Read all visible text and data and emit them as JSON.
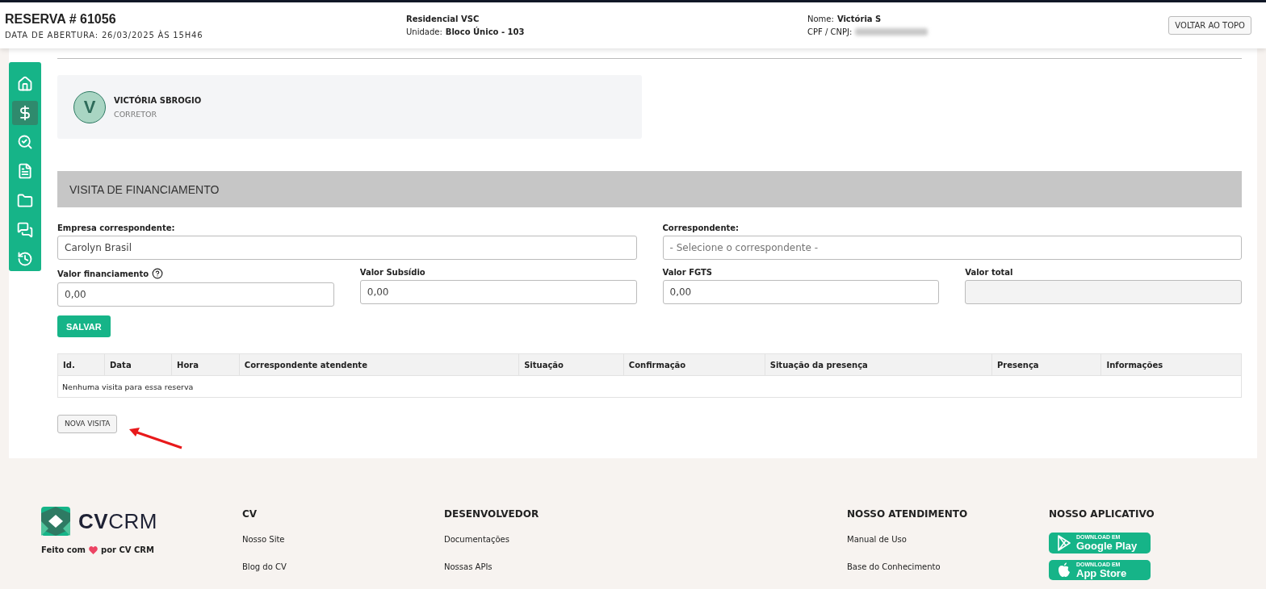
{
  "header": {
    "title": "RESERVA # 61056",
    "opening": "DATA DE ABERTURA: 26/03/2025 ÀS 15H46",
    "project": "Residencial VSC",
    "unit_label": "Unidade:",
    "unit_value": "Bloco Único - 103",
    "name_label": "Nome:",
    "name_value": "Victória S",
    "cpf_label": "CPF / CNPJ:",
    "cpf_redacted": true,
    "back_button": "VOLTAR AO TOPO"
  },
  "sidebar": {
    "items": [
      {
        "kind": "home",
        "selected": false
      },
      {
        "kind": "dollar",
        "selected": true
      },
      {
        "kind": "search",
        "selected": false
      },
      {
        "kind": "document",
        "selected": false
      },
      {
        "kind": "folder",
        "selected": false
      },
      {
        "kind": "chat",
        "selected": false
      },
      {
        "kind": "history",
        "selected": false
      }
    ]
  },
  "agent": {
    "initial": "V",
    "name": "VICTÓRIA SBROGIO",
    "role": "CORRETOR"
  },
  "section": {
    "title": "VISITA DE FINANCIAMENTO"
  },
  "fields": [
    {
      "kind": "text",
      "label": "Empresa correspondente:",
      "value": "Carolyn Brasil",
      "wide": true
    },
    {
      "kind": "select",
      "label": "Correspondente:",
      "placeholder": "- Selecione o correspondente -",
      "wide": true
    },
    {
      "kind": "text",
      "label": "Valor financiamento",
      "value": "0,00",
      "wide": false,
      "help": true
    },
    {
      "kind": "text",
      "label": "Valor Subsídio",
      "value": "0,00",
      "wide": false
    },
    {
      "kind": "text",
      "label": "Valor FGTS",
      "value": "0,00",
      "wide": false
    },
    {
      "kind": "readonly",
      "label": "Valor total",
      "wide": false
    }
  ],
  "save_button": "SALVAR",
  "table": {
    "columns": [
      "Id.",
      "Data",
      "Hora",
      "Correspondente atendente",
      "Situação",
      "Confirmação",
      "Situação da presença",
      "Presença",
      "Informações"
    ],
    "empty": "Nenhuma visita para essa reserva"
  },
  "new_visit_button": "NOVA VISITA",
  "footer": {
    "logo": "**CV**CRM",
    "made_with": [
      "Feito com",
      "por CV CRM"
    ],
    "columns": [
      {
        "title": "CV",
        "links": [
          "Nosso Site",
          "Blog do CV"
        ]
      },
      {
        "title": "DESENVOLVEDOR",
        "links": [
          "Documentações",
          "Nossas APIs"
        ]
      },
      {
        "title": "NOSSO ATENDIMENTO",
        "links": [
          "Manual de Uso",
          "Base do Conhecimento"
        ]
      }
    ],
    "app": {
      "title": "NOSSO APLICATIVO",
      "badges": [
        {
          "kind": "google",
          "small": "DOWNLOAD EM",
          "store": "Google Play"
        },
        {
          "kind": "apple",
          "small": "DOWNLOAD EM",
          "store": "App Store"
        }
      ]
    }
  }
}
